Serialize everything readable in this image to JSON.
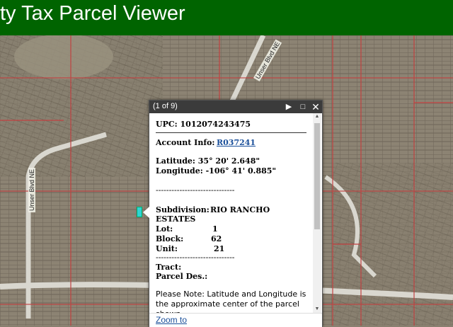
{
  "header": {
    "title": "ty Tax Parcel Viewer"
  },
  "map": {
    "road_labels": [
      "Unser Blvd NE",
      "Unser Blvd NE"
    ],
    "colors": {
      "parcel_line": "#c24040",
      "road": "#d9d7cf",
      "terrain": "#8a8070"
    }
  },
  "popup": {
    "count": "(1 of 9)",
    "controls": {
      "next": "▶",
      "maximize": "□",
      "close": "✕"
    },
    "upc": "UPC: 1012074243475",
    "account_label": "Account Info:",
    "account_link": "R037241",
    "latitude": "Latitude: 35° 20' 2.648\"",
    "longitude": "Longitude: -106° 41' 0.885\"",
    "separator": "------------------------------",
    "subdivision_label": "Subdivision:",
    "subdivision_value_1": "RIO RANCHO",
    "subdivision_value_2": "ESTATES",
    "lot_label": "Lot:",
    "lot_value": "1",
    "block_label": "Block:",
    "block_value": "62",
    "unit_label": "Unit:",
    "unit_value": "21",
    "separator2": "------------------------------",
    "tract_label": "Tract:",
    "parcel_des_label": "Parcel Des.:",
    "note": "Please Note: Latitude and Longitude is the approximate center of the parcel shown.",
    "zoom_link": "Zoom to"
  }
}
